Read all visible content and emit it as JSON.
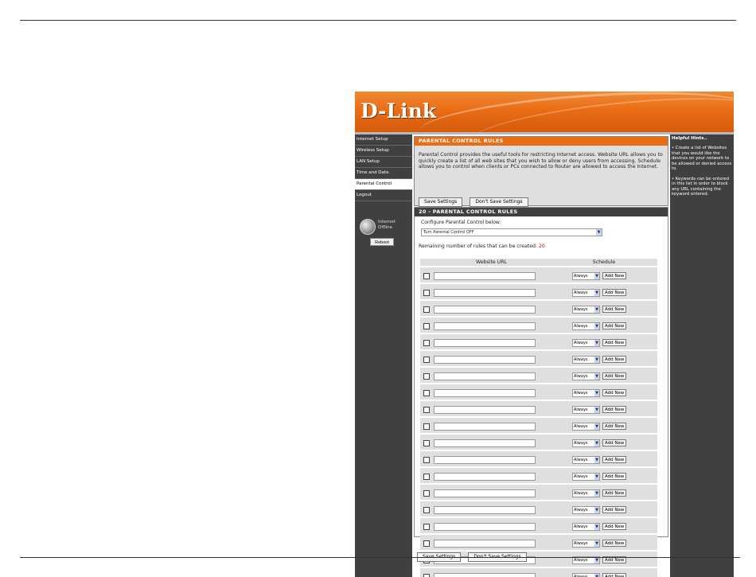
{
  "brand": {
    "logo": "D-Link"
  },
  "sidebar": {
    "items": [
      {
        "label": "Internet Setup"
      },
      {
        "label": "Wireless Setup"
      },
      {
        "label": "LAN Setup"
      },
      {
        "label": "Time and Date"
      },
      {
        "label": "Parental Control"
      },
      {
        "label": "Logout"
      }
    ],
    "status_line1": "Internet",
    "status_line2": "Offline",
    "reboot_label": "Reboot"
  },
  "rules_panel": {
    "title": "PARENTAL CONTROL RULES",
    "description": "Parental Control provides the useful tools for restricting Internet access. Website URL allows you to quickly create a list of all web sites that you wish to allow or deny users from accessing. Schedule allows you to control when clients or PCs connected to Router are allowed to access the Internet.",
    "save_label": "Save Settings",
    "dont_save_label": "Don't Save Settings"
  },
  "list_panel": {
    "title": "20 - PARENTAL CONTROL RULES",
    "configure_label": "Configure Parental Control below:",
    "configure_value": "Turn Parental Control OFF",
    "remaining_label": "Remaining number of rules that can be created:",
    "remaining_count": "20",
    "col_url": "Website URL",
    "col_schedule": "Schedule",
    "schedule_value": "Always",
    "add_new_label": "Add New",
    "row_count": 20
  },
  "bottom_buttons": {
    "save_label": "Save Settings",
    "dont_save_label": "Don't Save Settings"
  },
  "help": {
    "title": "Helpful Hints..",
    "hint1": "• Create a list of Websites that you would like the devices on your network to be allowed or denied access to.",
    "hint2": "• Keywords can be entered in this list in order to block any URL containing the keyword entered."
  },
  "colors": {
    "orange": "#ea6d15",
    "dark": "#404040"
  }
}
